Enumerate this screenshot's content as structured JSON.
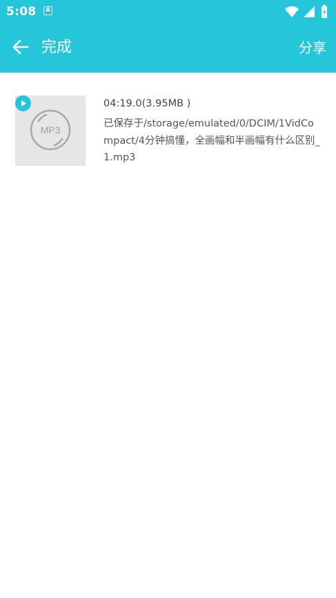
{
  "status_bar": {
    "time": "5:08",
    "notification_icon": "a-icon",
    "icons": [
      "wifi-icon",
      "signal-icon",
      "battery-icon"
    ]
  },
  "toolbar": {
    "back_icon": "arrow-back-icon",
    "title": "完成",
    "share_label": "分享"
  },
  "item": {
    "thumbnail_label": "MP3",
    "duration_size": "04:19.0(3.95MB )",
    "saved_path": "已保存于/storage/emulated/0/DCIM/1VidCompact/4分钟搞懂，全画幅和半画幅有什么区别_1.mp3"
  },
  "colors": {
    "accent": "#26c6da",
    "text_primary": "#444444",
    "text_secondary": "#555555",
    "thumb_bg": "#e6e6e6"
  }
}
